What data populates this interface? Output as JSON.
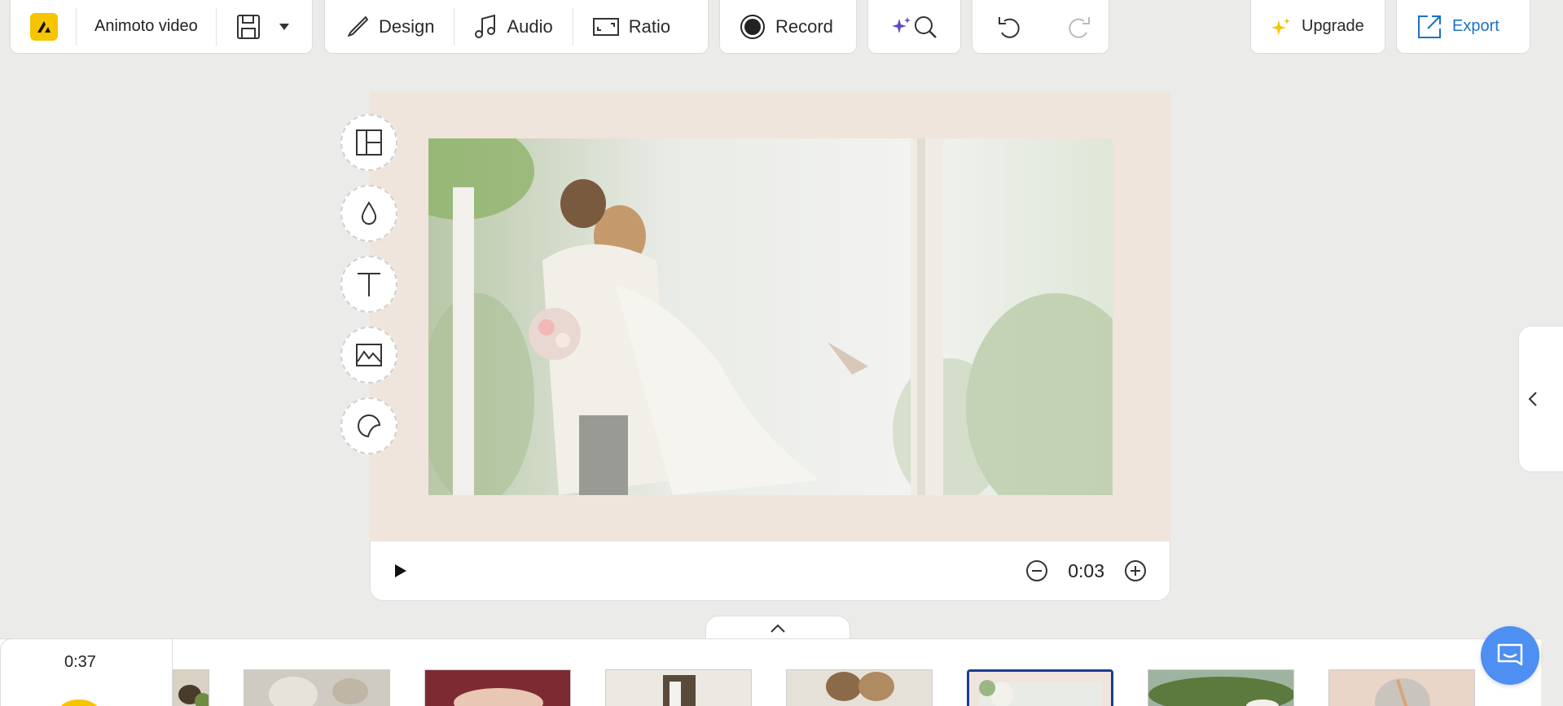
{
  "toolbar": {
    "project_title": "Animoto video",
    "design_label": "Design",
    "audio_label": "Audio",
    "ratio_label": "Ratio",
    "record_label": "Record",
    "upgrade_label": "Upgrade",
    "export_label": "Export"
  },
  "icons": {
    "logo": "animoto-logo-icon",
    "save": "save-icon",
    "dropdown": "caret-down-icon",
    "design": "brush-icon",
    "audio": "music-note-icon",
    "ratio": "aspect-ratio-icon",
    "record": "record-icon",
    "magic_search": "sparkle-search-icon",
    "undo": "undo-icon",
    "redo": "redo-icon",
    "upgrade": "sparkle-icon",
    "export": "export-icon"
  },
  "side_tools": [
    "layout-icon",
    "color-drop-icon",
    "text-icon",
    "image-icon",
    "sticker-icon"
  ],
  "player": {
    "time": "0:03",
    "play_icon": "play-icon",
    "minus_icon": "zoom-out-icon",
    "plus_icon": "zoom-in-icon"
  },
  "timeline": {
    "total_duration": "0:37",
    "selected_index": 5,
    "thumbnail_count": 8
  },
  "colors": {
    "accent_yellow": "#f7c400",
    "export_blue": "#1a73c6",
    "selected_border": "#1b3d8f",
    "chat_blue": "#4d8ff2",
    "canvas_bg": "#efe5dc"
  }
}
